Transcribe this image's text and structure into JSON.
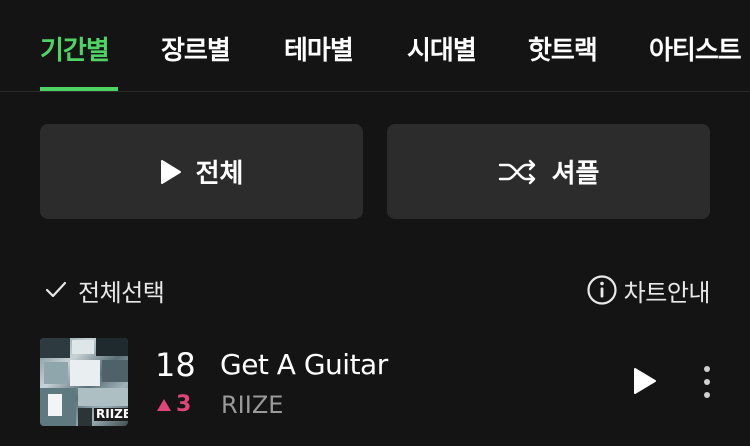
{
  "tabs": [
    {
      "label": "기간별",
      "active": true
    },
    {
      "label": "장르별",
      "active": false
    },
    {
      "label": "테마별",
      "active": false
    },
    {
      "label": "시대별",
      "active": false
    },
    {
      "label": "핫트랙",
      "active": false
    },
    {
      "label": "아티스트",
      "active": false
    }
  ],
  "actions": {
    "play_all_label": "전체",
    "shuffle_label": "셔플"
  },
  "toolbar": {
    "select_all_label": "전체선택",
    "chart_info_label": "차트안내"
  },
  "tracks": [
    {
      "rank": "18",
      "rank_change": "3",
      "rank_direction": "up",
      "title": "Get A Guitar",
      "artist": "RIIZE",
      "album_text": "RIIZE"
    }
  ],
  "colors": {
    "background": "#141414",
    "accent": "#4fd364",
    "rank_up": "#e0457a",
    "button_bg": "#2c2c2c"
  }
}
